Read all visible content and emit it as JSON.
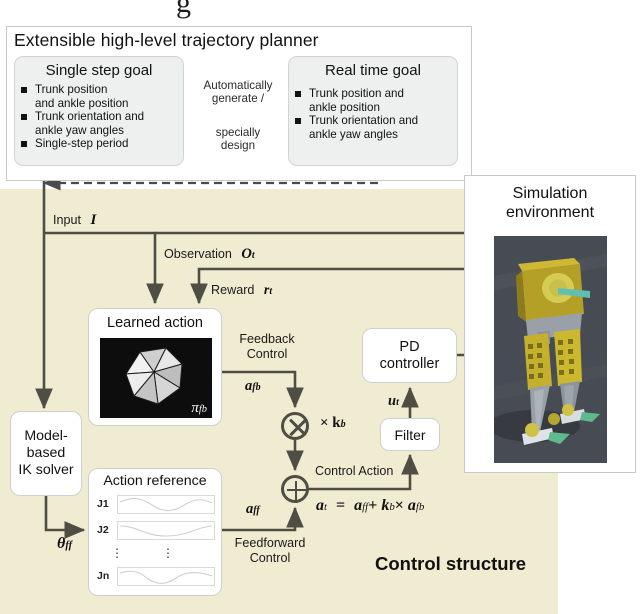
{
  "planner": {
    "title": "Extensible  high-level trajectory planner",
    "single_step_goal": {
      "title": "Single step goal",
      "bullets": [
        "Trunk position",
        "and ankle position",
        "Trunk orientation and",
        "ankle yaw angles",
        "Single-step period"
      ]
    },
    "link_text_top": "Automatically\ngenerate /",
    "link_text_top_line1": "Automatically",
    "link_text_top_line2": "generate /",
    "link_text_bottom_line1": "specially",
    "link_text_bottom_line2": "design",
    "real_time_goal": {
      "title": "Real time goal",
      "bullets": [
        "Trunk position and",
        "ankle position",
        "Trunk orientation and",
        "ankle yaw angles"
      ]
    }
  },
  "control": {
    "panel_title": "Control structure",
    "input_label": "Input",
    "input_symbol": "I",
    "observation_label": "Observation",
    "observation_symbol": "O",
    "observation_sub": "t",
    "reward_label": "Reward",
    "reward_symbol": "r",
    "reward_sub": "t",
    "learned_action": {
      "title": "Learned action",
      "policy_symbol": "π",
      "policy_sub": "fb"
    },
    "ik_solver": {
      "line1": "Model-",
      "line2": "based",
      "line3": "IK solver"
    },
    "theta_symbol": "θ",
    "theta_sub": "ff",
    "action_reference": {
      "title": "Action reference",
      "rows": [
        "J1",
        "J2",
        "Jn"
      ],
      "ellipsis": "⋮"
    },
    "feedback_control_line1": "Feedback",
    "feedback_control_line2": "Control",
    "feedforward_control_line1": "Feedforward",
    "feedforward_control_line2": "Control",
    "a_fb_symbol": "a",
    "a_fb_sub": "fb",
    "a_ff_symbol": "a",
    "a_ff_sub": "ff",
    "gain_label": "× k",
    "gain_sub": "b",
    "control_action_label": "Control Action",
    "equation": "aₜ  =  aғғ + kʙ × aғʙ",
    "equation_parts": {
      "lhs": "a",
      "lhs_sub": "t",
      "eq": "=",
      "t1": "a",
      "t1_sub": "ff",
      "plus": "+",
      "t2": "k",
      "t2_sub": "b",
      "times": "×",
      "t3": "a",
      "t3_sub": "fb"
    },
    "u_symbol": "u",
    "u_sub": "t",
    "filter_label": "Filter",
    "pd_controller_line1": "PD",
    "pd_controller_line2": "controller"
  },
  "simulation": {
    "title_line1": "Simulation",
    "title_line2": "environment"
  },
  "colors": {
    "panel_yellow": "#f0ecd2",
    "arrow_gray": "#4e4e44",
    "goal_box_gray": "#eef0ef",
    "node_white": "#ffffff",
    "sim_bg": "#474b53"
  }
}
